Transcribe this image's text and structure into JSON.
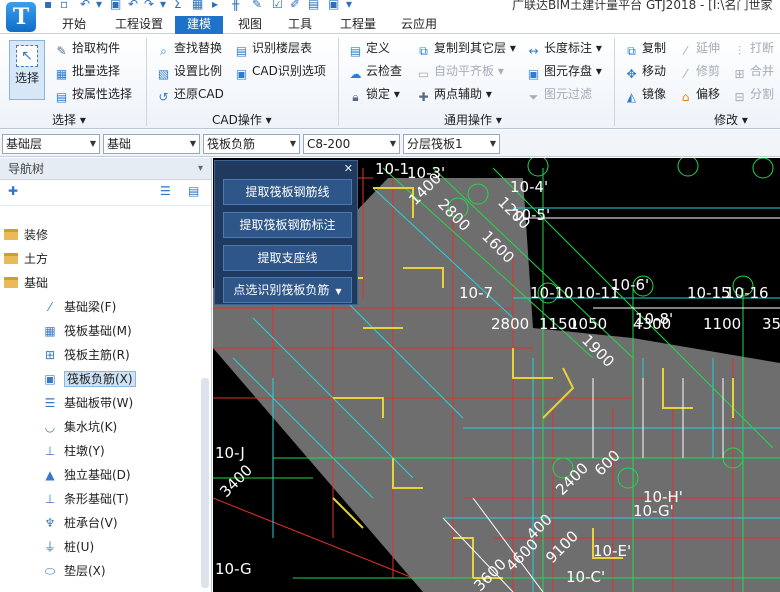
{
  "app": {
    "title": "广联达BIM土建计量平台 GTJ2018 - [I:\\名门世家",
    "logo": "T"
  },
  "quick_access": [
    "save-icon",
    "undo-icon",
    "redo-icon",
    "sum-icon",
    "print-icon",
    "edit-icon"
  ],
  "menu": {
    "tabs": [
      "开始",
      "工程设置",
      "建模",
      "视图",
      "工具",
      "工程量",
      "云应用"
    ],
    "active": "建模"
  },
  "ribbon": {
    "select_group": {
      "big_button": "选择",
      "label": "选择",
      "items": [
        "拾取构件",
        "批量选择",
        "按属性选择"
      ]
    },
    "find_group": {
      "items": [
        "查找替换",
        "设置比例",
        "还原CAD",
        "识别楼层表",
        "CAD识别选项"
      ]
    },
    "cad_label": "CAD操作",
    "common_group": {
      "items": [
        "定义",
        "云检查",
        "锁定",
        "复制到其它层",
        "自动平齐板",
        "两点辅助",
        "长度标注",
        "图元存盘",
        "图元过滤"
      ],
      "label": "通用操作"
    },
    "modify_group": {
      "items": [
        "复制",
        "移动",
        "镜像",
        "延伸",
        "修剪",
        "偏移",
        "打断",
        "合并",
        "分割"
      ],
      "label": "修改"
    }
  },
  "propbar": {
    "floor": "基础层",
    "category": "基础",
    "element_type": "筏板负筋",
    "rebar": "C8-200",
    "layer": "分层筏板1"
  },
  "nav": {
    "title": "导航树",
    "folders": [
      "装修",
      "土方",
      "基础"
    ],
    "items": [
      "基础梁(F)",
      "筏板基础(M)",
      "筏板主筋(R)",
      "筏板负筋(X)",
      "基础板带(W)",
      "集水坑(K)",
      "柱墩(Y)",
      "独立基础(D)",
      "条形基础(T)",
      "桩承台(V)",
      "桩(U)",
      "垫层(X)"
    ],
    "selected": "筏板负筋(X)"
  },
  "float_panel": {
    "buttons": [
      "提取筏板钢筋线",
      "提取筏板钢筋标注",
      "提取支座线",
      "点选识别筏板负筋"
    ]
  },
  "canvas": {
    "labels": [
      "10-1",
      "10-3'",
      "10-4'",
      "10-5'",
      "10-7",
      "10-10",
      "10-11",
      "10-6'",
      "10-15",
      "10-16",
      "10-8'",
      "10-J",
      "10-H'",
      "10-G'",
      "10-E'",
      "10-C'",
      "10-G",
      "1400",
      "2800",
      "1600",
      "1200",
      "2800",
      "1150",
      "1050",
      "4300",
      "1100",
      "1900",
      "2400",
      "600",
      "400",
      "3400",
      "4600",
      "9100",
      "3600",
      "35"
    ],
    "colors": {
      "background": "#000000",
      "red": "#e0302a",
      "cyan": "#28d2dc",
      "yellow": "#e8d23a",
      "green": "#23d84a",
      "white": "#ffffff",
      "gray": "#6e6e6e"
    }
  }
}
